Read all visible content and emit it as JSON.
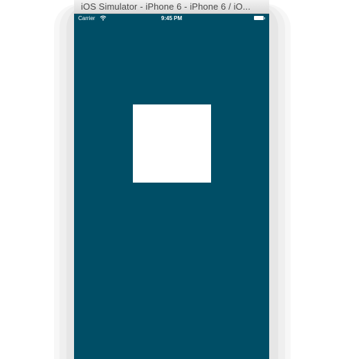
{
  "window": {
    "title": "iOS Simulator - iPhone 6 - iPhone 6 / iO..."
  },
  "status_bar": {
    "carrier": "Carrier",
    "time": "9:45 PM",
    "wifi_icon": "wifi-icon",
    "battery_icon": "battery-icon"
  },
  "colors": {
    "screen_background": "#004e66",
    "square": "#ffffff"
  }
}
